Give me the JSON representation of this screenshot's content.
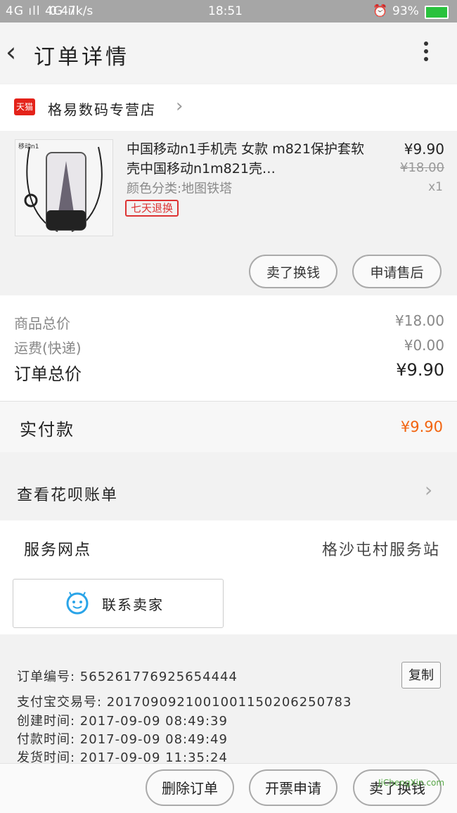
{
  "status_bar": {
    "signal": "4G ıll 4G ıll",
    "net_speed": "0.47k/s",
    "time": "18:51",
    "battery": "93%"
  },
  "nav": {
    "title": "订单详情"
  },
  "shop": {
    "badge": "天猫",
    "name": "格易数码专营店"
  },
  "product": {
    "thumb_text": "移动n1",
    "title": "中国移动n1手机壳 女款 m821保护套软壳中国移动n1m821壳…",
    "spec": "颜色分类:地图铁塔",
    "tag": "七天退换",
    "price": "¥9.90",
    "original_price": "¥18.00",
    "quantity": "x1"
  },
  "actions": {
    "refund": "卖了换钱",
    "after_sale": "申请售后"
  },
  "summary": {
    "goods_total_label": "商品总价",
    "goods_total": "¥18.00",
    "shipping_label": "运费(快递)",
    "shipping": "¥0.00",
    "order_total_label": "订单总价",
    "order_total": "¥9.90"
  },
  "paid": {
    "label": "实付款",
    "value": "¥9.90"
  },
  "huabei": {
    "label": "查看花呗账单"
  },
  "service": {
    "label": "服务网点",
    "value": "格沙屯村服务站",
    "contact": "联系卖家"
  },
  "order_info": {
    "order_no": "订单编号: 565261776925654444",
    "alipay_no": "支付宝交易号: 2017090921001001150206250783",
    "created": "创建时间: 2017-09-09 08:49:39",
    "paid_at": "付款时间: 2017-09-09 08:49:49",
    "shipped": "发货时间: 2017-09-09 11:35:24",
    "copy": "复制"
  },
  "bottom": {
    "delete": "删除订单",
    "invoice": "开票申请",
    "sell": "卖了换钱"
  },
  "watermark": "JiChengXin.com",
  "colors": {
    "accent_orange": "#f2640f",
    "tmall_red": "#e4231a",
    "tag_red": "#dd3333",
    "battery_green": "#29c23d"
  }
}
